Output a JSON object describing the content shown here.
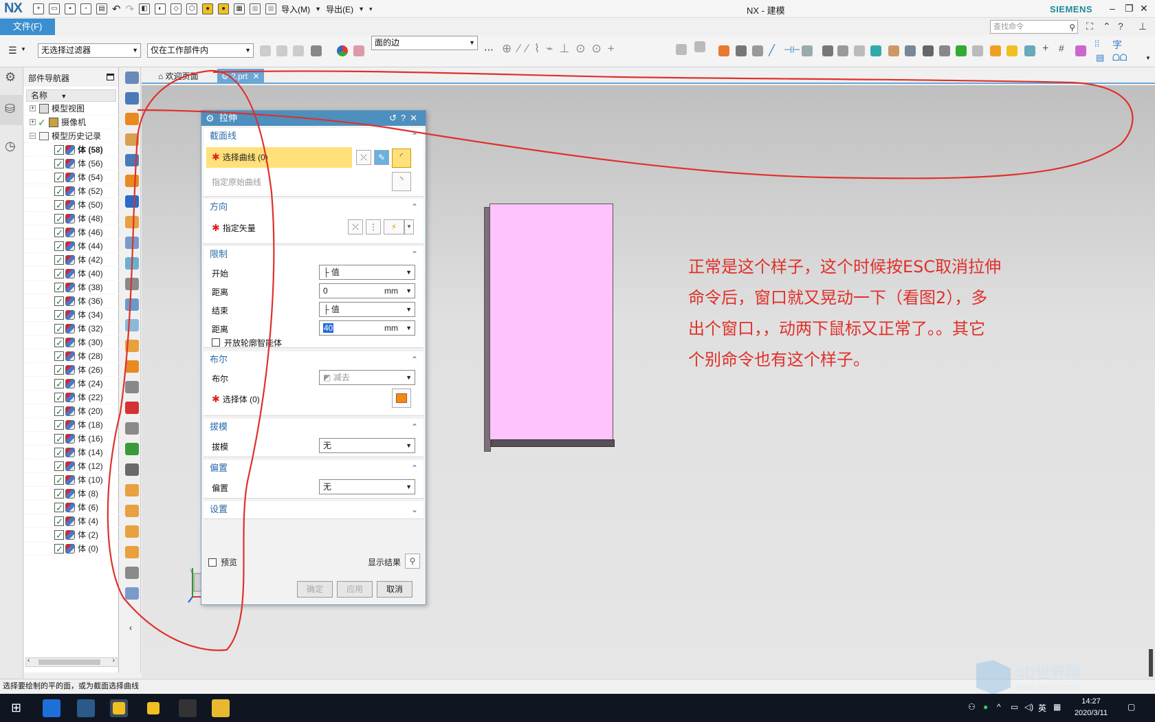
{
  "app": {
    "logo": "NX",
    "title": "NX - 建模",
    "brand": "SIEMENS"
  },
  "quick_access": {
    "import_menu": "导入(M)",
    "export_menu": "导出(E)"
  },
  "ribbon": {
    "file_tab": "文件(F)",
    "search_placeholder": "查找命令"
  },
  "selection_bar": {
    "filter": "无选择过滤器",
    "scope": "仅在工作部件内",
    "curve_rule": "面的边"
  },
  "navigator": {
    "title": "部件导航器",
    "column_name": "名称",
    "nodes": [
      {
        "label": "模型视图"
      },
      {
        "label": "摄像机"
      },
      {
        "label": "模型历史记录"
      }
    ],
    "bodies": [
      "体 (58)",
      "体 (56)",
      "体 (54)",
      "体 (52)",
      "体 (50)",
      "体 (48)",
      "体 (46)",
      "体 (44)",
      "体 (42)",
      "体 (40)",
      "体 (38)",
      "体 (36)",
      "体 (34)",
      "体 (32)",
      "体 (30)",
      "体 (28)",
      "体 (26)",
      "体 (24)",
      "体 (22)",
      "体 (20)",
      "体 (18)",
      "体 (16)",
      "体 (14)",
      "体 (12)",
      "体 (10)",
      "体 (8)",
      "体 (6)",
      "体 (4)",
      "体 (2)",
      "体 (0)"
    ]
  },
  "tabs": {
    "welcome": "欢迎页面",
    "part": "2.prt"
  },
  "dialog": {
    "title": "拉伸",
    "section_curve": {
      "header": "截面线",
      "select_curve": "选择曲线 (0)",
      "specify_original": "指定原始曲线"
    },
    "direction": {
      "header": "方向",
      "specify_vector": "指定矢量"
    },
    "limits": {
      "header": "限制",
      "start_label": "开始",
      "start_value": "值",
      "dist1_label": "距离",
      "dist1_value": "0",
      "dist1_unit": "mm",
      "end_label": "结束",
      "end_value": "值",
      "dist2_label": "距离",
      "dist2_value": "40",
      "dist2_unit": "mm",
      "open_profile": "开放轮廓智能体"
    },
    "boolean": {
      "header": "布尔",
      "label": "布尔",
      "value": "减去",
      "select_body": "选择体 (0)"
    },
    "draft": {
      "header": "拔模",
      "label": "拔模",
      "value": "无"
    },
    "offset": {
      "header": "偏置",
      "label": "偏置",
      "value": "无"
    },
    "settings": {
      "header": "设置"
    },
    "preview_label": "预览",
    "show_result": "显示结果",
    "ok": "确定",
    "apply": "应用",
    "cancel": "取消"
  },
  "annotation": {
    "lines": [
      "正常是这个样子，这个时候按ESC取消拉伸",
      "命令后，窗口就又晃动一下（看图2），多",
      "出个窗口，，动两下鼠标又正常了。。其它",
      "个别命令也有这个样子。"
    ],
    "color": "#e0302a"
  },
  "triad": {
    "x": "X",
    "y": "Y"
  },
  "status_bar": "选择要绘制的平的面，或为截面选择曲线",
  "taskbar": {
    "time": "14:27",
    "date": "2020/3/11",
    "ime": "英"
  },
  "watermark": {
    "text": "3D世界网",
    "url": "WWW.3DSJW.COM"
  },
  "colors": {
    "accent": "#4d8fbe",
    "part_face": "#fec3fd",
    "annotation_red": "#e0302a"
  }
}
